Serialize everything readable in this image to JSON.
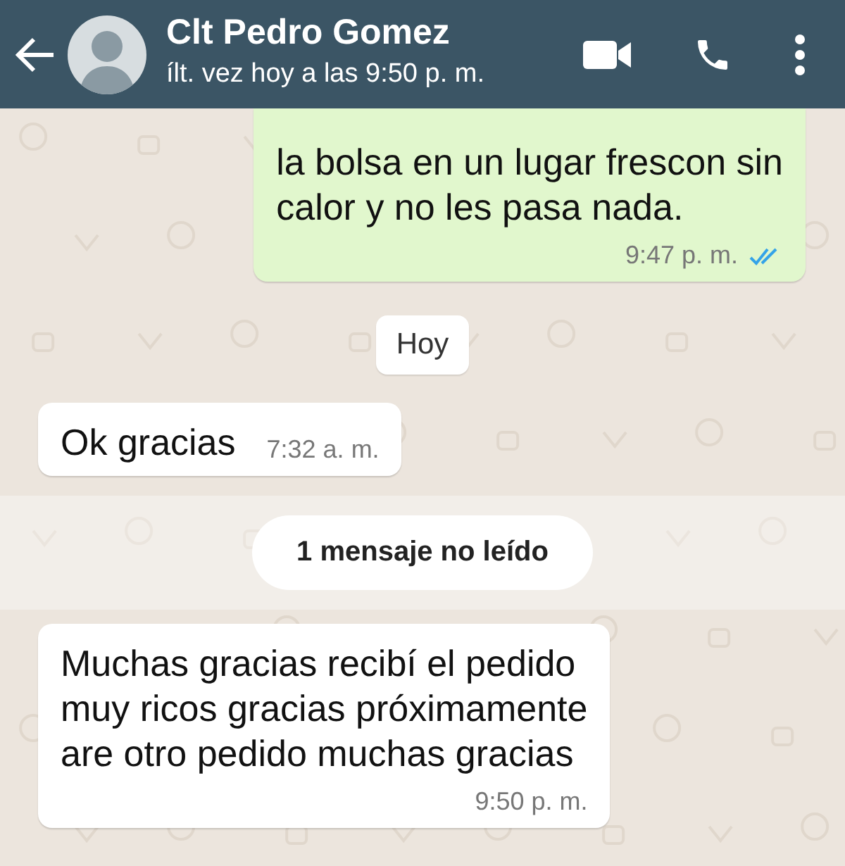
{
  "header": {
    "title": "Clt Pedro Gomez",
    "status": "ílt. vez hoy a las 9:50 p. m."
  },
  "messages": [
    {
      "kind": "outgoing",
      "text": "la bolsa en un lugar frescon sin\ncalor y no les pasa nada.",
      "time": "9:47 p. m.",
      "read": true
    },
    {
      "kind": "date",
      "text": "Hoy"
    },
    {
      "kind": "incoming",
      "text": "Ok gracias",
      "time": "7:32 a. m."
    },
    {
      "kind": "unread",
      "text": "1 mensaje no leído"
    },
    {
      "kind": "incoming",
      "text": "Muchas gracias recibí el pedido\nmuy ricos gracias próximamente\nare otro pedido muchas gracias",
      "time": "9:50 p. m."
    }
  ]
}
